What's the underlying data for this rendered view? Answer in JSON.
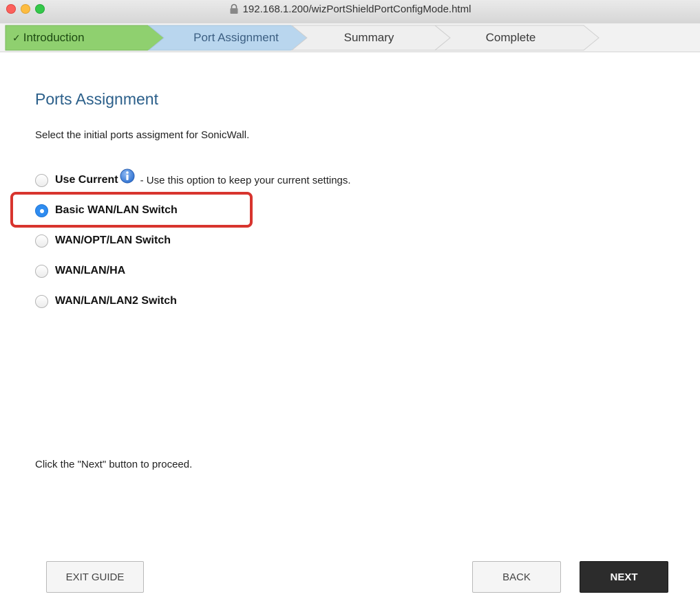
{
  "browser": {
    "url": "192.168.1.200/wizPortShieldPortConfigMode.html"
  },
  "wizard": {
    "steps": [
      {
        "label": "Introduction",
        "state": "done"
      },
      {
        "label": "Port Assignment",
        "state": "active"
      },
      {
        "label": "Summary",
        "state": "pending"
      },
      {
        "label": "Complete",
        "state": "pending"
      }
    ],
    "check_mark": "✓"
  },
  "content": {
    "title": "Ports Assignment",
    "description": "Select the initial ports assigment for SonicWall.",
    "options": [
      {
        "label": "Use Current",
        "description": "- Use this option to keep your current settings.",
        "selected": false,
        "has_info_icon": true
      },
      {
        "label": "Basic WAN/LAN Switch",
        "selected": true
      },
      {
        "label": "WAN/OPT/LAN Switch",
        "selected": false
      },
      {
        "label": "WAN/LAN/HA",
        "selected": false
      },
      {
        "label": "WAN/LAN/LAN2 Switch",
        "selected": false
      }
    ],
    "hint": "Click the \"Next\" button to proceed."
  },
  "buttons": {
    "exit": "EXIT GUIDE",
    "back": "BACK",
    "next": "NEXT"
  },
  "colors": {
    "step_done": "#8fd06f",
    "step_active": "#b9d6ee",
    "title": "#2b5f8a",
    "highlight": "#d8342e",
    "radio_selected": "#2f8cf0"
  }
}
